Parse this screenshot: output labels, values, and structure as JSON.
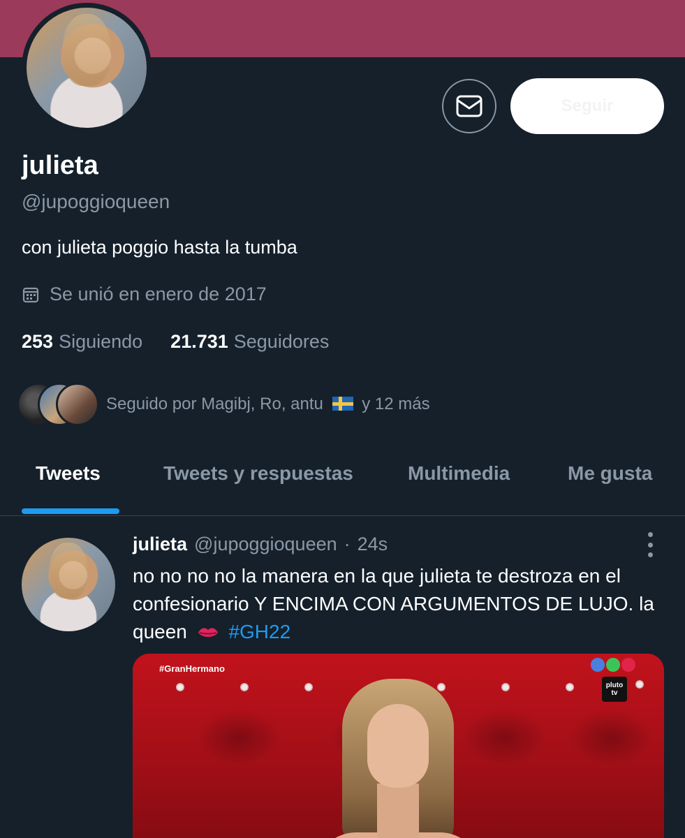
{
  "profile": {
    "follow_label": "Seguir",
    "name": "julieta",
    "handle": "@jupoggioqueen",
    "bio": "con julieta poggio hasta la tumba",
    "joined": "Se unió en enero de 2017",
    "following_count": "253",
    "following_label": "Siguiendo",
    "followers_count": "21.731",
    "followers_label": "Seguidores",
    "followed_by_prefix": "Seguido por Magibj, Ro, antu",
    "followed_by_suffix": "y 12 más"
  },
  "tabs": [
    {
      "label": "Tweets",
      "active": true
    },
    {
      "label": "Tweets y respuestas",
      "active": false
    },
    {
      "label": "Multimedia",
      "active": false
    },
    {
      "label": "Me gusta",
      "active": false
    }
  ],
  "tweet": {
    "name": "julieta",
    "handle": "@jupoggioqueen",
    "separator": "·",
    "time": "24s",
    "text_main": "no no no no la manera en la que julieta te destroza en el confesionario Y ENCIMA CON ARGUMENTOS DE LUJO. la queen",
    "hashtag": "#GH22",
    "media": {
      "tag": "#GranHermano",
      "logo_top": "pluto",
      "logo_bottom": "tv"
    }
  },
  "colors": {
    "background": "#15202b",
    "banner": "#9b3a5a",
    "accent": "#1d9bf0",
    "muted_text": "#8b98a5"
  },
  "icons": {
    "message": "envelope-icon",
    "calendar": "calendar-icon",
    "more": "more-vertical-icon",
    "emoji": "kiss-lips-icon",
    "flag": "sweden-flag-icon"
  }
}
